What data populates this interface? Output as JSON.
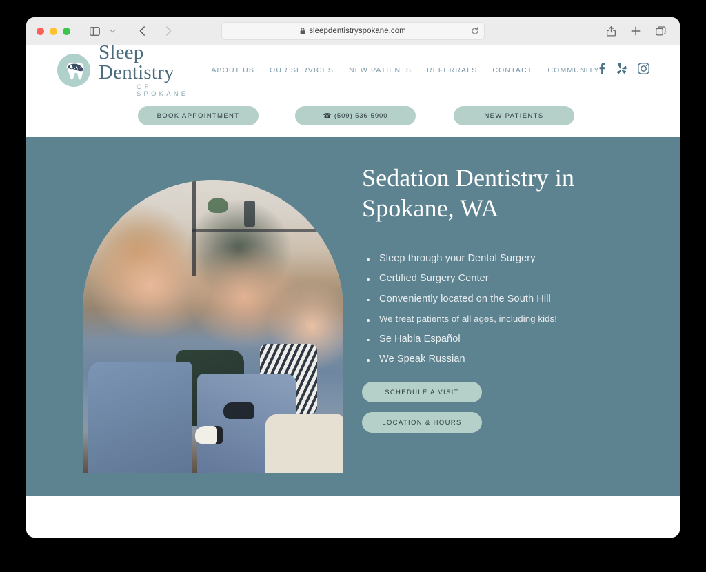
{
  "browser": {
    "window_controls": [
      "close",
      "minimize",
      "maximize"
    ],
    "sidebar_icon": "sidebar-icon",
    "dropdown_icon": "chevron-down-icon",
    "back_icon": "chevron-left-icon",
    "forward_icon": "chevron-right-icon",
    "address": {
      "url": "sleepdentistryspokane.com",
      "lock_icon": "lock-icon",
      "reload_icon": "reload-icon"
    },
    "actions": {
      "share_icon": "share-icon",
      "new_tab_icon": "plus-icon",
      "tab_overview_icon": "tabs-icon"
    }
  },
  "site": {
    "brand": {
      "name": "Sleep Dentistry",
      "tagline": "OF SPOKANE",
      "logo_icon": "sleeping-tooth-logo"
    },
    "nav": [
      {
        "label": "ABOUT US"
      },
      {
        "label": "OUR SERVICES"
      },
      {
        "label": "NEW PATIENTS"
      },
      {
        "label": "REFERRALS"
      },
      {
        "label": "CONTACT"
      },
      {
        "label": "COMMUNITY"
      }
    ],
    "social": [
      {
        "name": "facebook-icon",
        "label": "Facebook"
      },
      {
        "name": "yelp-icon",
        "label": "Yelp"
      },
      {
        "name": "instagram-icon",
        "label": "Instagram"
      }
    ],
    "cta_bar": {
      "book": "BOOK APPOINTMENT",
      "phone": "☎ (509) 536-5900",
      "new_patients": "NEW PATIENTS"
    },
    "hero": {
      "title_line1": "Sedation Dentistry in",
      "title_line2": "Spokane, WA",
      "bullets": [
        {
          "text": "Sleep through your Dental Surgery",
          "small": false
        },
        {
          "text": "Certified Surgery Center",
          "small": false
        },
        {
          "text": "Conveniently located on the South Hill",
          "small": false
        },
        {
          "text": "We treat patients of all ages, including kids!",
          "small": true
        },
        {
          "text": "Se Habla Español",
          "small": false
        },
        {
          "text": "We Speak Russian",
          "small": false
        }
      ],
      "buttons": [
        {
          "label": "SCHEDULE A VISIT"
        },
        {
          "label": "LOCATION & HOURS"
        }
      ],
      "image_alt": "family-photo-arch"
    }
  },
  "colors": {
    "hero_background": "#5D8391",
    "pill_background": "#B4D0C9",
    "brand_text": "#4A6C7C",
    "nav_text": "#7B99A9",
    "logo_circle": "#AFD0CB"
  }
}
